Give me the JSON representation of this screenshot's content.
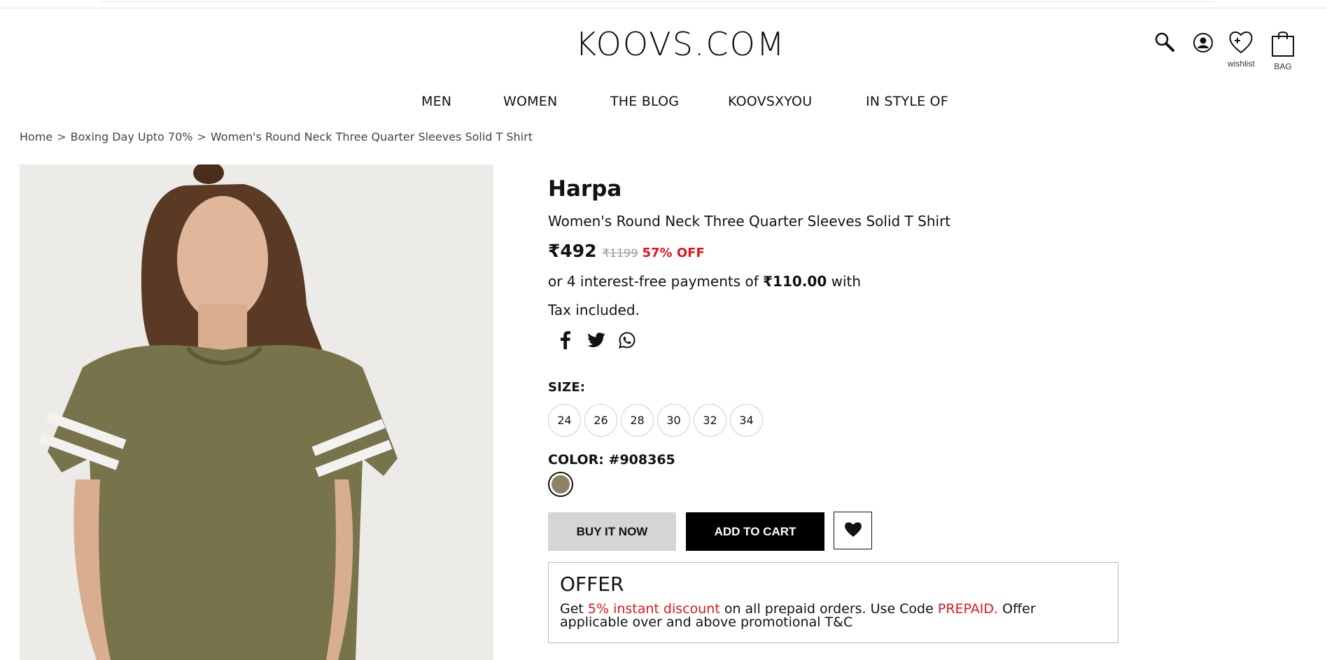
{
  "header": {
    "logo": "KOOVS.COM",
    "icons": {
      "search": "search-icon",
      "account": "user-icon",
      "wishlist_label": "wishlist",
      "bag_label": "BAG"
    }
  },
  "nav": {
    "items": [
      {
        "label": "MEN"
      },
      {
        "label": "WOMEN"
      },
      {
        "label": "THE BLOG"
      },
      {
        "label": "KOOVSXYOU"
      },
      {
        "label": "IN STYLE OF"
      }
    ]
  },
  "breadcrumb": {
    "items": [
      "Home",
      "Boxing Day Upto 70%",
      "Women's Round Neck Three Quarter Sleeves Solid T Shirt"
    ],
    "separator": ">"
  },
  "product": {
    "brand": "Harpa",
    "title": "Women's Round Neck Three Quarter Sleeves Solid T Shirt",
    "price": "₹492",
    "mrp": "₹1199",
    "discount": "57% OFF",
    "emi_prefix": "or 4 interest-free payments of ",
    "emi_amount": "₹110.00",
    "emi_suffix": " with",
    "tax_note": "Tax included.",
    "share_icons": [
      "facebook-icon",
      "twitter-icon",
      "whatsapp-icon"
    ],
    "size_label": "SIZE:",
    "sizes": [
      "24",
      "26",
      "28",
      "30",
      "32",
      "34"
    ],
    "color_label": "COLOR: #908365",
    "color_hex": "#908365",
    "buy_now_label": "BUY IT NOW",
    "add_to_cart_label": "ADD TO CART"
  },
  "offer": {
    "heading": "OFFER",
    "text_1": "Get ",
    "text_red_1": "5% instant discount",
    "text_2": " on all prepaid orders. Use Code ",
    "text_red_2": "PREPAID.",
    "text_3": " Offer applicable over and above promotional T&C"
  },
  "colors": {
    "accent_red": "#e0161e",
    "primary_black": "#000000",
    "buy_now_bg": "#d5d5d5",
    "product_color": "#908365"
  }
}
